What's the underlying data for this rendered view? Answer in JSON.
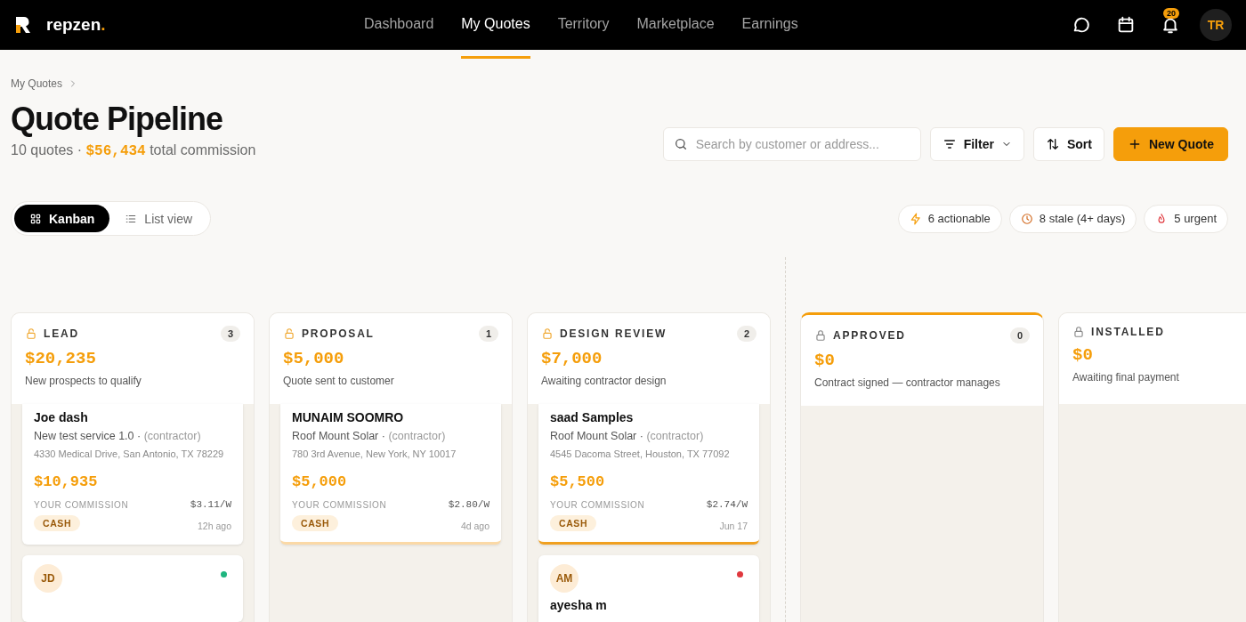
{
  "header": {
    "brand": {
      "name": "repzen",
      "mark": "."
    },
    "nav": [
      {
        "label": "Dashboard",
        "selected": false
      },
      {
        "label": "My Quotes",
        "selected": true
      },
      {
        "label": "Territory",
        "selected": false
      },
      {
        "label": "Marketplace",
        "selected": false
      },
      {
        "label": "Earnings",
        "selected": false
      }
    ],
    "notifications_count": "20",
    "avatar": "TR"
  },
  "breadcrumb": [
    "My Quotes"
  ],
  "title": "Quote Pipeline",
  "summary": {
    "count": "10 quotes",
    "separator": "·",
    "total": "$56,434",
    "suffix": "total commission"
  },
  "search": {
    "placeholder": "Search by customer or address..."
  },
  "buttons": [
    {
      "kind": "filter",
      "label": "Filter"
    },
    {
      "kind": "sort",
      "label": "Sort"
    },
    {
      "kind": "new",
      "label": "New Quote"
    }
  ],
  "views": [
    {
      "kind": "grid",
      "label": "Kanban",
      "selected": true
    },
    {
      "kind": "list",
      "label": "List view",
      "selected": false
    }
  ],
  "chips": [
    {
      "kind": "bolt",
      "label": "6 actionable"
    },
    {
      "kind": "clock",
      "label": "8 stale (4+ days)"
    },
    {
      "kind": "flame",
      "label": "5 urgent"
    }
  ],
  "columns": [
    {
      "title": "LEAD",
      "count": "3",
      "amount": "$20,235",
      "description": "New prospects to qualify",
      "unlocked": true,
      "highlighted": false,
      "divider_before": false,
      "cards": [
        {
          "kind": "quote",
          "name": "Joe dash",
          "service": "New test service 1.0",
          "separator": "·",
          "role": "(contractor)",
          "address": "4330 Medical Drive, San Antonio, TX 78229",
          "commission": "$10,935",
          "commission_label": "YOUR COMMISSION",
          "rate": "$3.11/W",
          "tag": "CASH",
          "time": "12h ago"
        },
        {
          "kind": "contact",
          "initials": "JD",
          "color": "#1fb57f"
        }
      ]
    },
    {
      "title": "PROPOSAL",
      "count": "1",
      "amount": "$5,000",
      "description": "Quote sent to customer",
      "unlocked": true,
      "highlighted": false,
      "divider_before": false,
      "cards": [
        {
          "kind": "quote",
          "name": "MUNAIM SOOMRO",
          "service": "Roof Mount Solar",
          "separator": "·",
          "role": "(contractor)",
          "address": "780 3rd Avenue, New York, NY 10017",
          "commission": "$5,000",
          "commission_label": "YOUR COMMISSION",
          "rate": "$2.80/W",
          "tag": "CASH",
          "time": "4d ago",
          "color": "#fbd9a6"
        }
      ]
    },
    {
      "title": "DESIGN REVIEW",
      "count": "2",
      "amount": "$7,000",
      "description": "Awaiting contractor design",
      "unlocked": true,
      "highlighted": false,
      "divider_before": false,
      "cards": [
        {
          "kind": "quote",
          "name": "saad Samples",
          "service": "Roof Mount Solar",
          "separator": "·",
          "role": "(contractor)",
          "address": "4545 Dacoma Street, Houston, TX 77092",
          "commission": "$5,500",
          "commission_label": "YOUR COMMISSION",
          "rate": "$2.74/W",
          "tag": "CASH",
          "time": "Jun 17",
          "color": "#f0a020"
        },
        {
          "kind": "contact",
          "initials": "AM",
          "color": "#e0383e",
          "name": "ayesha m"
        }
      ]
    },
    {
      "title": "APPROVED",
      "count": "0",
      "amount": "$0",
      "description": "Contract signed — contractor manages",
      "unlocked": false,
      "highlighted": true,
      "divider_before": true
    },
    {
      "title": "INSTALLED",
      "amount": "$0",
      "description": "Awaiting final payment",
      "unlocked": false,
      "highlighted": false,
      "divider_before": false
    }
  ]
}
